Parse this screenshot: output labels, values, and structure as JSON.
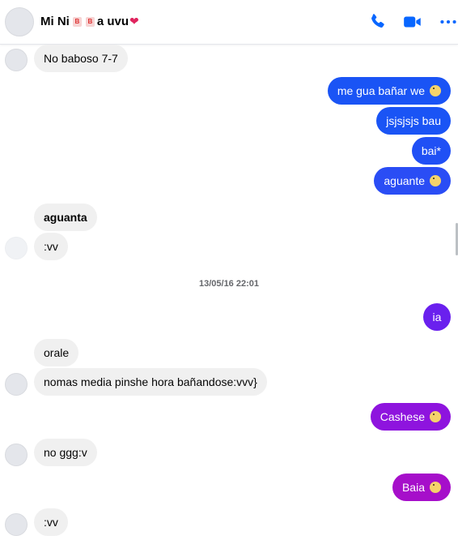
{
  "header": {
    "title_prefix": "Mi Ni",
    "title_badge_1": "B",
    "title_badge_2": "B",
    "title_suffix": " a uvu",
    "heart_icon": "heart-icon",
    "actions": [
      "phone-icon",
      "video-icon",
      "more-icon"
    ],
    "accent_color": "#0866ff"
  },
  "messages": {
    "m1": "No baboso 7-7",
    "m2": "me gua bañar we",
    "m3": "jsjsjsjs bau",
    "m4": "bai*",
    "m5": "aguante",
    "m6": "aguanta",
    "m7": ":vv",
    "timestamp": "13/05/16 22:01",
    "m8": "ia",
    "m9": "orale",
    "m10": "nomas media pinshe hora bañandose:vvv}",
    "m11": "Cashese",
    "m12": "no ggg:v",
    "m13": "Baia",
    "m14": ":vv"
  },
  "colors": {
    "out_blue": "#1a54f5",
    "out_indigo": "#4a3df0",
    "out_purple": "#7a1ff0",
    "out_violet": "#8e14de",
    "out_magenta": "#a60fca",
    "in_bg": "#f0f0f0"
  }
}
